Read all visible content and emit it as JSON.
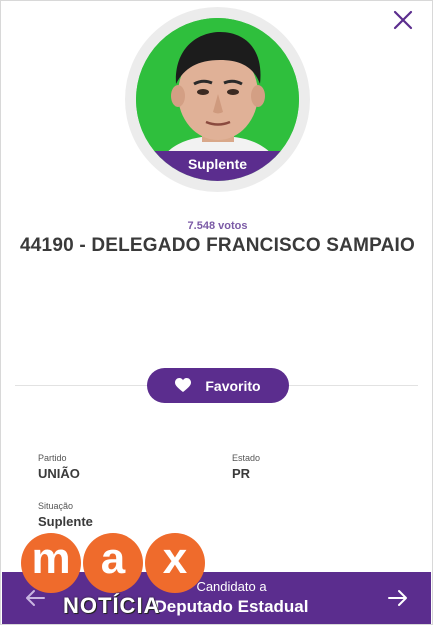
{
  "candidate": {
    "status_badge": "Suplente",
    "votes": "7.548 votos",
    "name": "44190 - DELEGADO FRANCISCO SAMPAIO"
  },
  "actions": {
    "favorite_label": "Favorito"
  },
  "info": {
    "partido_label": "Partido",
    "partido_value": "UNIÃO",
    "estado_label": "Estado",
    "estado_value": "PR",
    "situacao_label": "Situação",
    "situacao_value": "Suplente"
  },
  "footer": {
    "line1": "Candidato a",
    "line2": "Deputado Estadual"
  },
  "watermark": {
    "letters": [
      "m",
      "a",
      "x"
    ],
    "text": "NOTÍCIA"
  },
  "colors": {
    "accent": "#5b2d8e",
    "photo_background": "#2fbf3d",
    "watermark": "#ef6b2c"
  },
  "icons": {
    "close": "close-icon",
    "favorite": "heart-icon",
    "prev": "arrow-left-icon",
    "next": "arrow-right-icon"
  }
}
